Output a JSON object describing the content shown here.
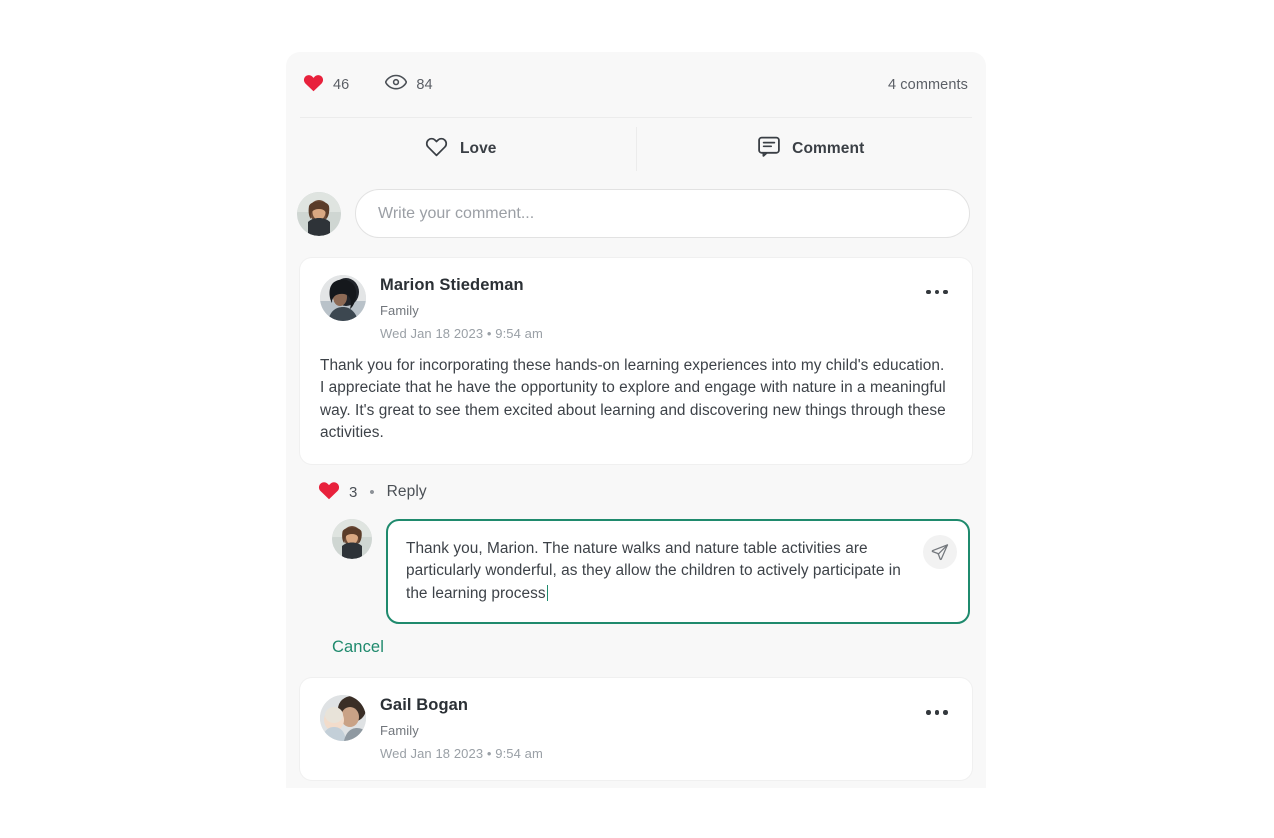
{
  "post_stats": {
    "love_icon": "heart-filled-icon",
    "love_count": "46",
    "view_icon": "eye-icon",
    "view_count": "84",
    "comments_summary": "4 comments"
  },
  "actions": {
    "love": {
      "icon": "heart-outline-icon",
      "label": "Love"
    },
    "comment": {
      "icon": "comment-bubble-icon",
      "label": "Comment"
    }
  },
  "composer": {
    "avatar": "current-user-avatar",
    "placeholder": "Write your comment...",
    "value": ""
  },
  "comments": [
    {
      "avatar": "marion-avatar",
      "name": "Marion Stiedeman",
      "role": "Family",
      "date": "Wed Jan 18 2023 • 9:54 am",
      "body": "Thank you for incorporating these hands-on learning experiences into my child's education. I appreciate that he have the opportunity to explore and engage with nature in a meaningful way. It's great to see them excited about learning and discovering new things through these activities.",
      "menu_icon": "more-options-icon",
      "love_icon": "heart-filled-icon",
      "love_count": "3",
      "separator": "•",
      "reply_label": "Reply"
    },
    {
      "avatar": "gail-avatar",
      "name": "Gail Bogan",
      "role": "Family",
      "date": "Wed Jan 18 2023 • 9:54 am",
      "menu_icon": "more-options-icon"
    }
  ],
  "reply_composer": {
    "avatar": "current-user-avatar",
    "value": "Thank you, Marion. The nature walks and nature table activities are particularly wonderful, as they allow the children to actively participate in the learning process",
    "send_icon": "send-paper-plane-icon",
    "cancel_label": "Cancel"
  },
  "colors": {
    "accent_teal": "#1f8a6d",
    "heart_red": "#e8213c",
    "page_bg": "#ffffff",
    "card_bg": "#f8f8f8",
    "comment_bg": "#ffffff"
  }
}
